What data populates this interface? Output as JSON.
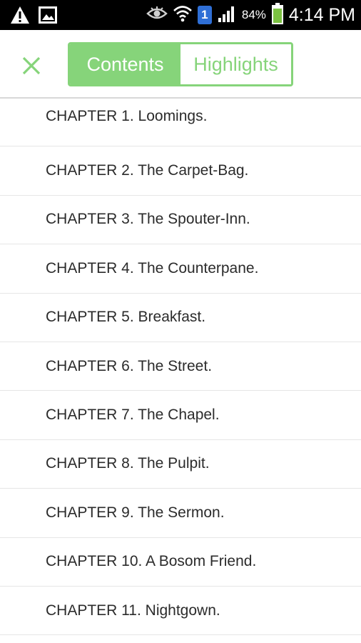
{
  "status_bar": {
    "notification_count": "1",
    "battery_percent": "84%",
    "time": "4:14 PM",
    "icons": [
      "warning-icon",
      "image-icon",
      "eye-icon",
      "wifi-icon",
      "signal-icon",
      "battery-icon"
    ]
  },
  "header": {
    "close_icon": "close-icon",
    "tabs": [
      {
        "label": "Contents",
        "active": true
      },
      {
        "label": "Highlights",
        "active": false
      }
    ]
  },
  "chapters": [
    {
      "label": "CHAPTER 1. Loomings."
    },
    {
      "label": "CHAPTER 2. The Carpet-Bag."
    },
    {
      "label": "CHAPTER 3. The Spouter-Inn."
    },
    {
      "label": "CHAPTER 4. The Counterpane."
    },
    {
      "label": "CHAPTER 5. Breakfast."
    },
    {
      "label": "CHAPTER 6. The Street."
    },
    {
      "label": "CHAPTER 7. The Chapel."
    },
    {
      "label": "CHAPTER 8. The Pulpit."
    },
    {
      "label": "CHAPTER 9. The Sermon."
    },
    {
      "label": "CHAPTER 10. A Bosom Friend."
    },
    {
      "label": "CHAPTER 11. Nightgown."
    }
  ],
  "colors": {
    "accent": "#86d47a",
    "text": "#2b2b2b",
    "divider": "#e6e6e6"
  }
}
